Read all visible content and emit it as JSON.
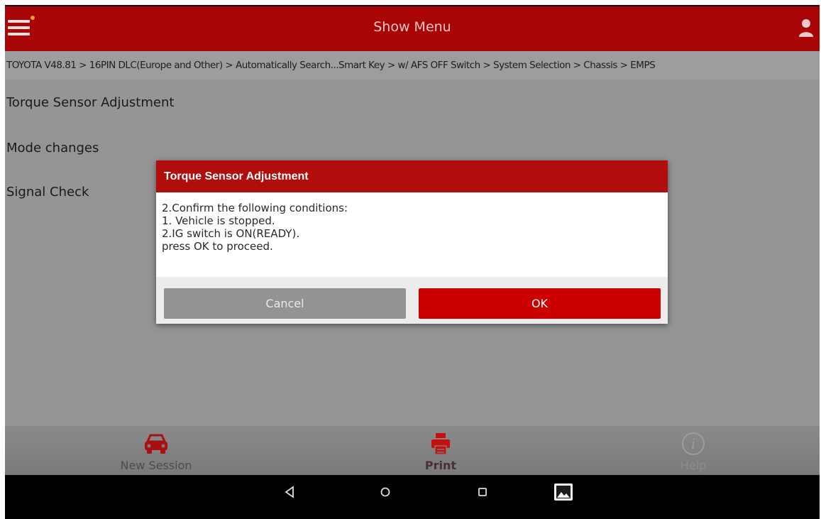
{
  "header": {
    "title": "Show Menu"
  },
  "breadcrumb": "TOYOTA V48.81 > 16PIN DLC(Europe and Other) > Automatically Search...Smart Key > w/ AFS OFF Switch > System Selection > Chassis > EMPS",
  "menu": {
    "items": [
      {
        "label": "Torque Sensor Adjustment"
      },
      {
        "label": "Mode changes"
      },
      {
        "label": "Signal Check"
      }
    ]
  },
  "dialog": {
    "title": "Torque Sensor Adjustment",
    "lines": [
      "2.Confirm the following conditions:",
      "1. Vehicle is stopped.",
      "2.IG switch is ON(READY).",
      "press OK to proceed."
    ],
    "cancel_label": "Cancel",
    "ok_label": "OK"
  },
  "toolbar": {
    "new_session_label": "New Session",
    "print_label": "Print",
    "help_label": "Help"
  },
  "colors": {
    "brand": "#a80507",
    "accent_button": "#cc0000"
  },
  "icons": {
    "menu": "hamburger-menu-icon",
    "user": "user-icon",
    "new_session": "car-icon",
    "print": "printer-icon",
    "help": "info-icon",
    "back": "back-triangle-icon",
    "home": "home-circle-icon",
    "recent": "recent-apps-icon",
    "screenshot": "screenshot-icon"
  }
}
